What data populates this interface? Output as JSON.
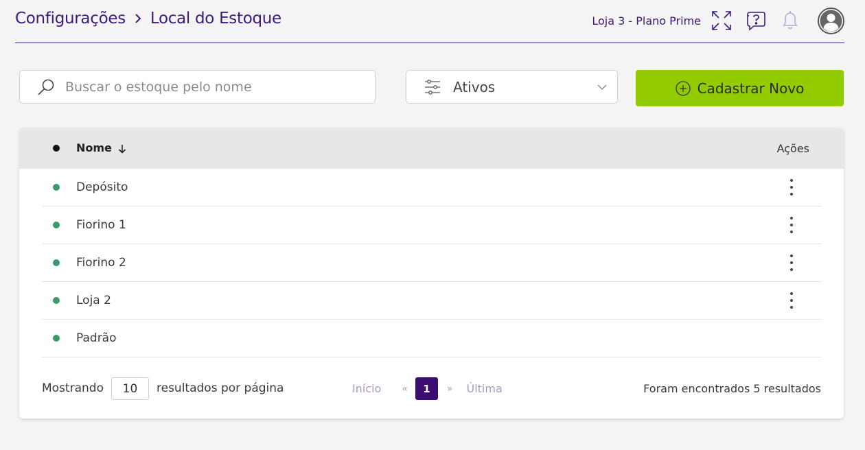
{
  "header": {
    "breadcrumb": [
      "Configurações",
      "Local do Estoque"
    ],
    "store_label": "Loja 3 - Plano Prime",
    "accent_color": "#3c1a78"
  },
  "toolbar": {
    "search_placeholder": "Buscar o estoque pelo nome",
    "filter_value": "Ativos",
    "new_button_label": "Cadastrar Novo",
    "new_button_color": "#92cc00"
  },
  "table": {
    "columns": {
      "name": "Nome",
      "actions": "Ações"
    },
    "rows": [
      {
        "name": "Depósito",
        "status": "active",
        "has_actions": true
      },
      {
        "name": "Fiorino 1",
        "status": "active",
        "has_actions": true
      },
      {
        "name": "Fiorino 2",
        "status": "active",
        "has_actions": true
      },
      {
        "name": "Loja 2",
        "status": "active",
        "has_actions": true
      },
      {
        "name": "Padrão",
        "status": "active",
        "has_actions": false
      }
    ],
    "status_color": "#3a9b6b"
  },
  "footer": {
    "showing_label": "Mostrando",
    "per_page": "10",
    "per_page_label": "resultados por página",
    "pagination": {
      "first": "Início",
      "prev": "«",
      "current": "1",
      "next": "»",
      "last": "Última"
    },
    "total_label": "Foram encontrados 5 resultados"
  }
}
